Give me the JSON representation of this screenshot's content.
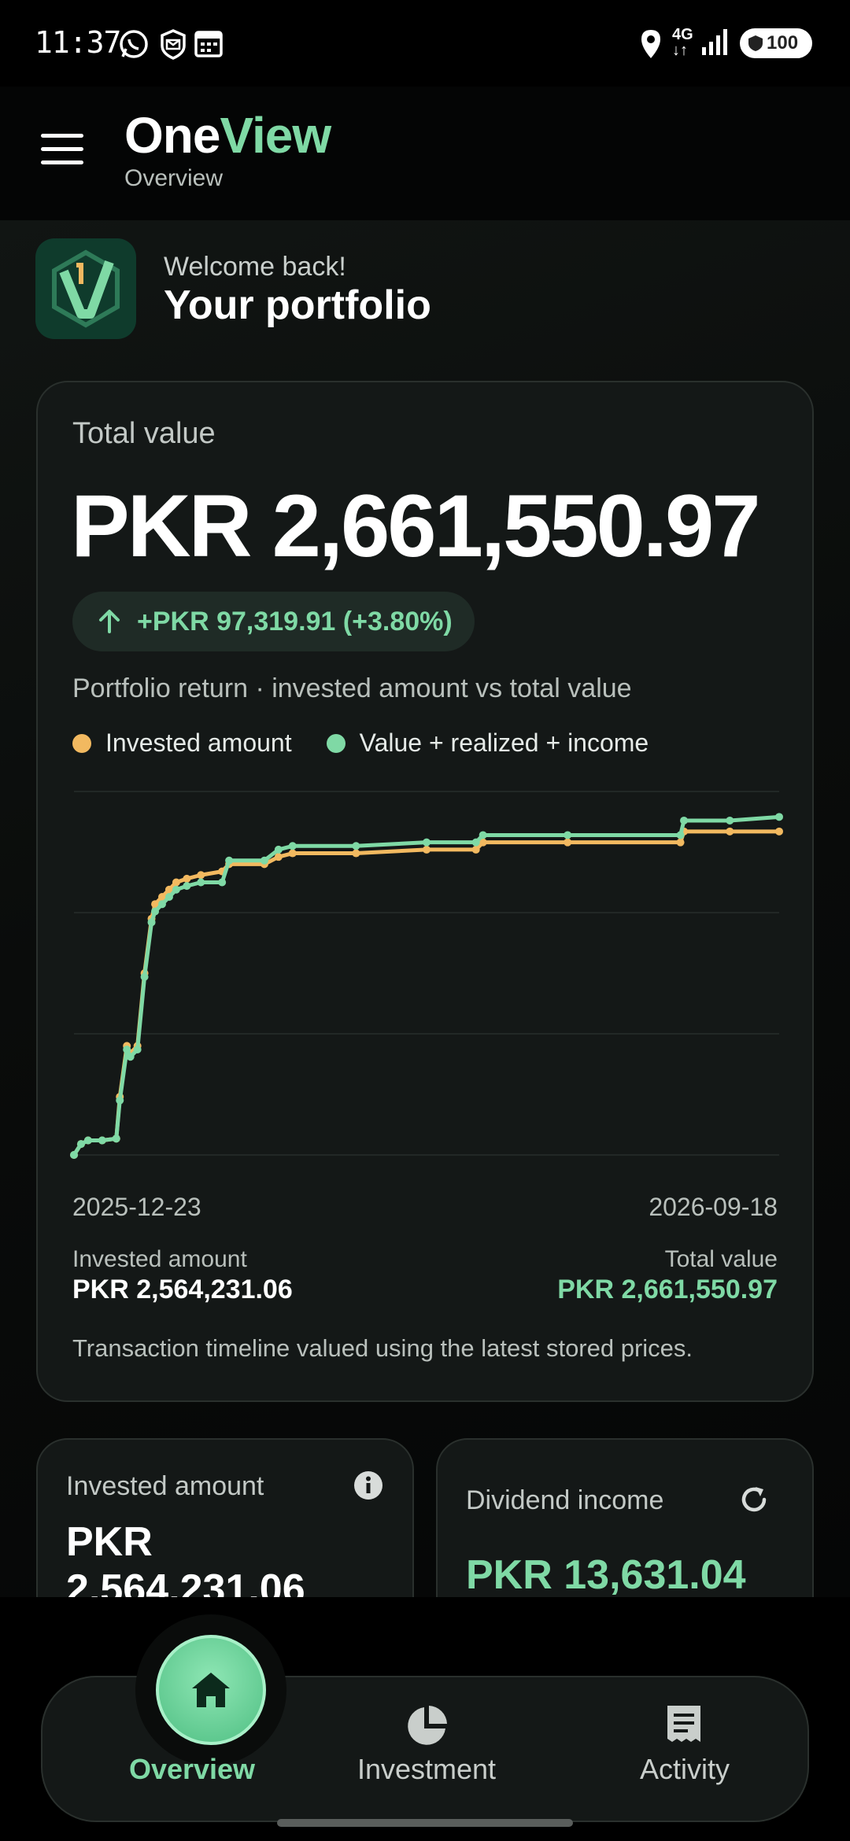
{
  "status_bar": {
    "time": "11:37",
    "battery": "100",
    "network": "4G",
    "icons": [
      "whatsapp-icon",
      "mail-shield-icon",
      "calendar-icon",
      "location-icon",
      "network-4g-icon",
      "signal-icon",
      "battery-icon"
    ]
  },
  "header": {
    "brand_part1": "One",
    "brand_part2": "View",
    "subtitle": "Overview"
  },
  "welcome": {
    "greeting": "Welcome back!",
    "title": "Your portfolio"
  },
  "total_card": {
    "label": "Total value",
    "value": "PKR 2,661,550.97",
    "change": "+PKR 97,319.91 (+3.80%)",
    "caption": "Portfolio return · invested amount vs total value",
    "legend": [
      {
        "label": "Invested amount",
        "color": "#f2b960"
      },
      {
        "label": "Value + realized + income",
        "color": "#7fd9a5"
      }
    ],
    "date_start": "2025-12-23",
    "date_end": "2026-09-18",
    "invested_label": "Invested amount",
    "invested_value": "PKR 2,564,231.06",
    "total_label": "Total value",
    "total_value": "PKR 2,661,550.97",
    "note": "Transaction timeline valued using the latest stored prices."
  },
  "chart_data": {
    "type": "line",
    "x_range": [
      "2025-12-23",
      "2026-09-18"
    ],
    "grid": true,
    "legend_position": "top-left",
    "y_axis_labels_shown": false,
    "series": [
      {
        "name": "Invested amount",
        "color": "#f2b960",
        "points": [
          [
            0,
            0.0
          ],
          [
            0.01,
            0.03
          ],
          [
            0.02,
            0.04
          ],
          [
            0.04,
            0.04
          ],
          [
            0.06,
            0.045
          ],
          [
            0.065,
            0.16
          ],
          [
            0.075,
            0.3
          ],
          [
            0.08,
            0.28
          ],
          [
            0.09,
            0.3
          ],
          [
            0.1,
            0.5
          ],
          [
            0.11,
            0.65
          ],
          [
            0.115,
            0.69
          ],
          [
            0.125,
            0.71
          ],
          [
            0.135,
            0.73
          ],
          [
            0.145,
            0.75
          ],
          [
            0.16,
            0.76
          ],
          [
            0.18,
            0.77
          ],
          [
            0.21,
            0.78
          ],
          [
            0.22,
            0.8
          ],
          [
            0.27,
            0.8
          ],
          [
            0.29,
            0.82
          ],
          [
            0.31,
            0.83
          ],
          [
            0.4,
            0.83
          ],
          [
            0.5,
            0.84
          ],
          [
            0.57,
            0.84
          ],
          [
            0.58,
            0.86
          ],
          [
            0.7,
            0.86
          ],
          [
            0.86,
            0.86
          ],
          [
            0.865,
            0.89
          ],
          [
            0.93,
            0.89
          ],
          [
            1.0,
            0.89
          ]
        ]
      },
      {
        "name": "Value + realized + income",
        "color": "#7fd9a5",
        "points": [
          [
            0,
            0.0
          ],
          [
            0.01,
            0.03
          ],
          [
            0.02,
            0.04
          ],
          [
            0.04,
            0.04
          ],
          [
            0.06,
            0.045
          ],
          [
            0.065,
            0.15
          ],
          [
            0.075,
            0.29
          ],
          [
            0.08,
            0.27
          ],
          [
            0.09,
            0.29
          ],
          [
            0.1,
            0.49
          ],
          [
            0.11,
            0.64
          ],
          [
            0.115,
            0.67
          ],
          [
            0.125,
            0.69
          ],
          [
            0.135,
            0.71
          ],
          [
            0.145,
            0.73
          ],
          [
            0.16,
            0.74
          ],
          [
            0.18,
            0.75
          ],
          [
            0.21,
            0.75
          ],
          [
            0.22,
            0.81
          ],
          [
            0.27,
            0.81
          ],
          [
            0.29,
            0.84
          ],
          [
            0.31,
            0.85
          ],
          [
            0.4,
            0.85
          ],
          [
            0.5,
            0.86
          ],
          [
            0.57,
            0.86
          ],
          [
            0.58,
            0.88
          ],
          [
            0.7,
            0.88
          ],
          [
            0.86,
            0.88
          ],
          [
            0.865,
            0.92
          ],
          [
            0.93,
            0.92
          ],
          [
            1.0,
            0.93
          ]
        ]
      }
    ]
  },
  "invested_card": {
    "label": "Invested amount",
    "value": "PKR 2,564,231.06"
  },
  "dividend_card": {
    "label": "Dividend income",
    "value": "PKR 13,631.04"
  },
  "bottom_nav": {
    "items": [
      {
        "label": "Overview",
        "active": true
      },
      {
        "label": "Investment",
        "active": false
      },
      {
        "label": "Activity",
        "active": false
      }
    ]
  },
  "colors": {
    "accent": "#7fd9a5",
    "invested": "#f2b960",
    "background": "#000000",
    "card": "#141817"
  }
}
